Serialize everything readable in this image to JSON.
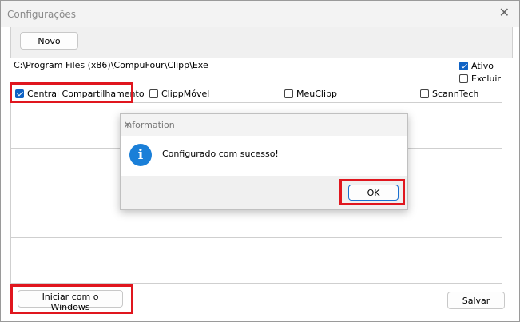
{
  "window": {
    "title": "Configurações"
  },
  "toolbar": {
    "novo_label": "Novo"
  },
  "config": {
    "path": "C:\\Program Files (x86)\\CompuFour\\Clipp\\Exe"
  },
  "flags": {
    "ativo_label": "Ativo",
    "ativo_checked": true,
    "excluir_label": "Excluir",
    "excluir_checked": false
  },
  "modules": [
    {
      "label": "Central Compartilhamento",
      "checked": true
    },
    {
      "label": "ClippMóvel",
      "checked": false
    },
    {
      "label": "MeuClipp",
      "checked": false
    },
    {
      "label": "ScannTech",
      "checked": false
    }
  ],
  "footer": {
    "startup_label": "Iniciar com o Windows",
    "save_label": "Salvar"
  },
  "dialog": {
    "title": "Information",
    "message": "Configurado com sucesso!",
    "ok_label": "OK"
  },
  "colors": {
    "highlight": "#e0161e",
    "accent": "#0f62c4",
    "info": "#1a7fd8"
  }
}
